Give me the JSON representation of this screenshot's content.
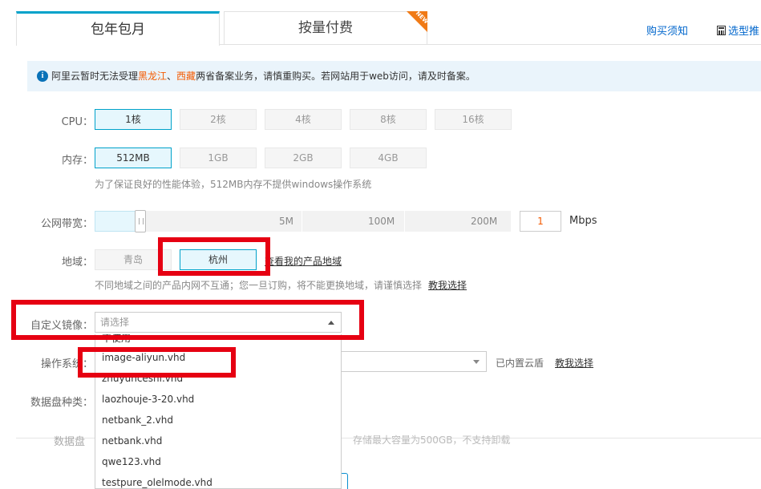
{
  "tabs": [
    {
      "label": "包年包月",
      "active": true
    },
    {
      "label": "按量付费",
      "active": false,
      "badge": "NEW"
    }
  ],
  "top_links": {
    "purchase_notice": "购买须知",
    "selection_guide": "选型推"
  },
  "notice": {
    "before": "阿里云暂时无法受理",
    "region1": "黑龙江",
    "sep": "、",
    "region2": "西藏",
    "after": "两省备案业务，请慎重购买。若网站用于web访问，请及时备案。"
  },
  "cpu": {
    "label": "CPU：",
    "options": [
      "1核",
      "2核",
      "4核",
      "8核",
      "16核"
    ],
    "selected": "1核"
  },
  "memory": {
    "label": "内存：",
    "options": [
      "512MB",
      "1GB",
      "2GB",
      "4GB"
    ],
    "selected": "512MB",
    "hint": "为了保证良好的性能体验，512MB内存不提供windows操作系统"
  },
  "bandwidth": {
    "label": "公网带宽：",
    "ticks": [
      "5M",
      "100M",
      "200M"
    ],
    "value": "1",
    "unit": "Mbps"
  },
  "region": {
    "label": "地域：",
    "options": [
      "青岛",
      "杭州"
    ],
    "selected": "杭州",
    "view_link": "查看我的产品地域",
    "hint": "不同地域之间的产品内网不互通；您一旦订购，将不能更换地域，请谨慎选择",
    "help_link": "教我选择"
  },
  "custom_image": {
    "label": "自定义镜像：",
    "placeholder": "请选择",
    "dropdown_options": [
      "不使用",
      "image-aliyun.vhd",
      "zhuyunceshi.vhd",
      "laozhouje-3-20.vhd",
      "netbank_2.vhd",
      "netbank.vhd",
      "qwe123.vhd",
      "testpure_olelmode.vhd"
    ]
  },
  "os": {
    "label": "操作系统：",
    "note": "已内置云盾",
    "help_link": "教我选择"
  },
  "data_disk": {
    "label": "数据盘种类："
  },
  "data_disk_row": {
    "label": "数据盘",
    "hint": "存储最大容量为500GB，不支持卸载"
  }
}
